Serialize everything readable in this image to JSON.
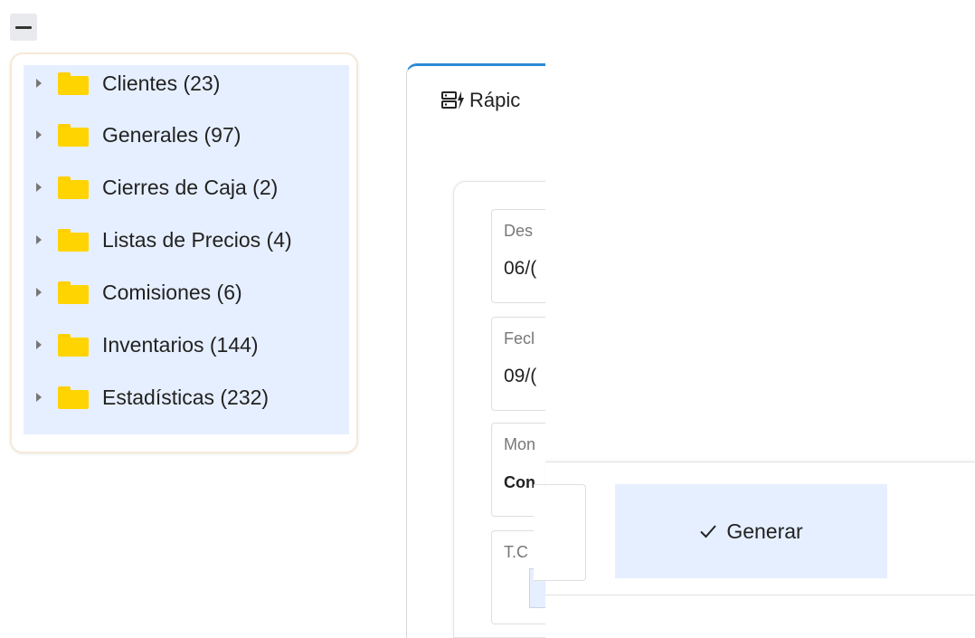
{
  "toolbar": {
    "collapse_icon": "minus-icon"
  },
  "tree": {
    "items": [
      {
        "label": "Clientes (23)",
        "icon": "folder-icon"
      },
      {
        "label": "Generales (97)",
        "icon": "folder-icon"
      },
      {
        "label": "Cierres de Caja (2)",
        "icon": "folder-icon"
      },
      {
        "label": "Listas de Precios (4)",
        "icon": "folder-icon"
      },
      {
        "label": "Comisiones (6)",
        "icon": "folder-icon"
      },
      {
        "label": "Inventarios (144)",
        "icon": "folder-icon"
      },
      {
        "label": "Estadísticas (232)",
        "icon": "folder-icon"
      }
    ]
  },
  "main": {
    "tab_title": "Rápic",
    "tab_icon": "quick-report-icon",
    "fields": [
      {
        "label": "Des",
        "value": "06/("
      },
      {
        "label": "Fecl",
        "value": "09/("
      },
      {
        "label": "Mon",
        "value": "Con"
      },
      {
        "label": "T.C",
        "value": ""
      }
    ]
  },
  "actions": {
    "generate_label": "Generar",
    "generate_icon": "check-icon"
  },
  "colors": {
    "accent": "#2d8ad6",
    "selection_bg": "#e6efff",
    "folder": "#ffd400"
  }
}
